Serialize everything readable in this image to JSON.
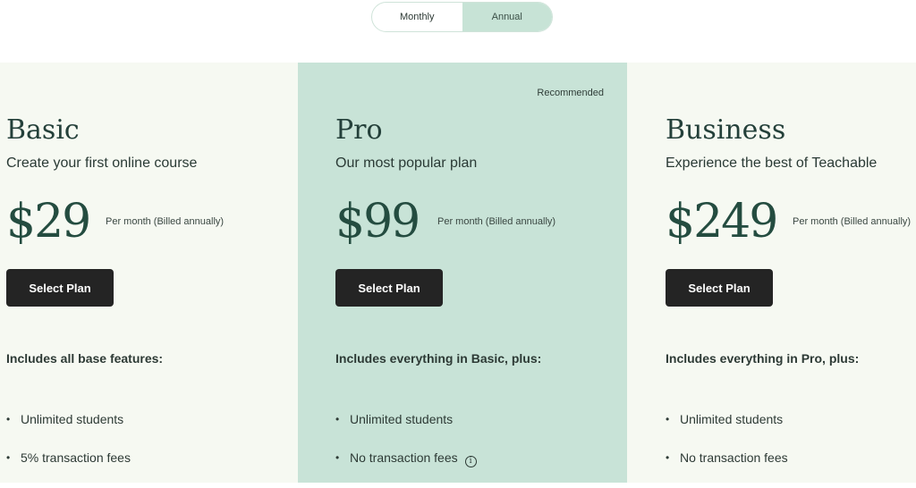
{
  "billing_toggle": {
    "options": [
      {
        "label": "Monthly",
        "active": false
      },
      {
        "label": "Annual",
        "active": true
      }
    ]
  },
  "plans": [
    {
      "name": "Basic",
      "description": "Create your first online course",
      "price": "$29",
      "billing": "Per month (Billed annually)",
      "button": "Select Plan",
      "includes": "Includes all base features:",
      "features": [
        "Unlimited students",
        "5% transaction fees"
      ]
    },
    {
      "badge": "Recommended",
      "name": "Pro",
      "description": "Our most popular plan",
      "price": "$99",
      "billing": "Per month (Billed annually)",
      "button": "Select Plan",
      "includes": "Includes everything in Basic, plus:",
      "features": [
        "Unlimited students",
        "No transaction fees"
      ],
      "info_icon": "i"
    },
    {
      "name": "Business",
      "description": "Experience the best of Teachable",
      "price": "$249",
      "billing": "Per month (Billed annually)",
      "button": "Select Plan",
      "includes": "Includes everything in Pro, plus:",
      "features": [
        "Unlimited students",
        "No transaction fees"
      ]
    }
  ],
  "bullet": "•",
  "colors": {
    "recommended_bg": "#c8e3d7",
    "card_bg": "#f6f9f2",
    "button_bg": "#242424",
    "price_text": "#244c40",
    "toggle_active_bg": "#c7e3d6"
  }
}
